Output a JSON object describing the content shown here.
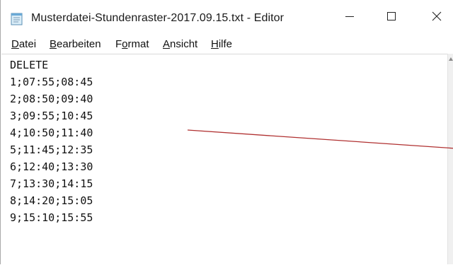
{
  "window": {
    "title": "Musterdatei-Stundenraster-2017.09.15.txt - Editor",
    "icon": "notepad-icon",
    "controls": {
      "minimize": "minimize-icon",
      "maximize": "maximize-icon",
      "close": "close-icon"
    }
  },
  "menu": {
    "items": [
      {
        "accel": "D",
        "rest": "atei"
      },
      {
        "accel": "B",
        "rest": "earbeiten"
      },
      {
        "pre": "F",
        "accel": "o",
        "rest": "rmat"
      },
      {
        "accel": "A",
        "rest": "nsicht"
      },
      {
        "accel": "H",
        "rest": "ilfe"
      }
    ]
  },
  "editor": {
    "lines": [
      "DELETE",
      "1;07:55;08:45",
      "2;08:50;09:40",
      "3;09:55;10:45",
      "4;10:50;11:40",
      "5;11:45;12:35",
      "6;12:40;13:30",
      "7;13:30;14:15",
      "8;14:20;15:05",
      "9;15:10;15:55"
    ]
  },
  "colors": {
    "annotation_line": "#b03030",
    "text": "#111111"
  }
}
